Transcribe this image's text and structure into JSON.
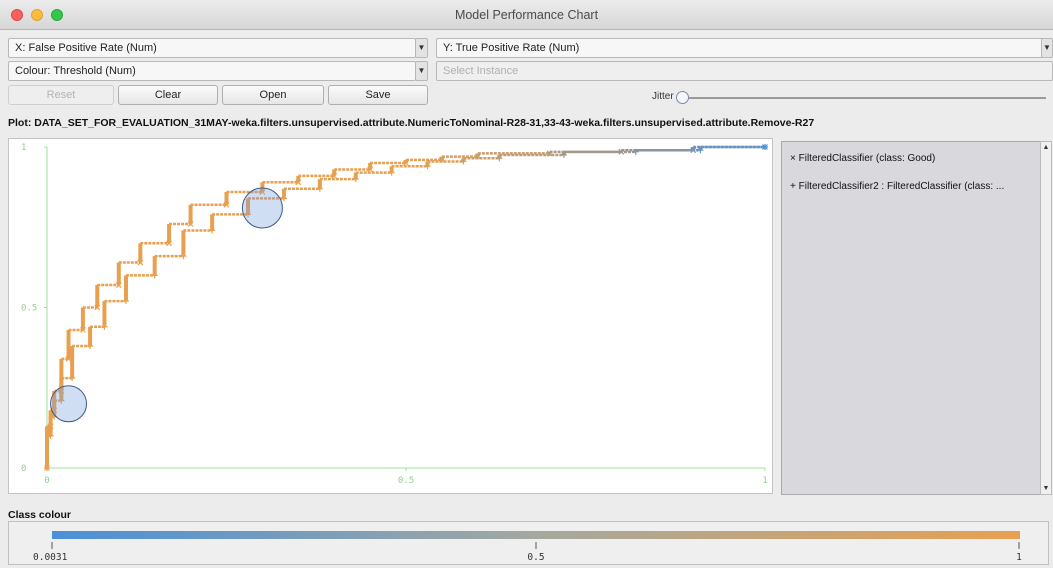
{
  "window": {
    "title": "Model Performance Chart"
  },
  "controls": {
    "x_axis": "X: False Positive Rate (Num)",
    "y_axis": "Y: True Positive Rate (Num)",
    "colour": "Colour: Threshold (Num)",
    "select_instance_placeholder": "Select Instance",
    "reset_label": "Reset",
    "clear_label": "Clear",
    "open_label": "Open",
    "save_label": "Save",
    "jitter_label": "Jitter",
    "jitter_value": 0
  },
  "plot": {
    "label": "Plot: DATA_SET_FOR_EVALUATION_31MAY-weka.filters.unsupervised.attribute.NumericToNominal-R28-31,33-43-weka.filters.unsupervised.attribute.Remove-R27"
  },
  "legend": {
    "items": [
      "× FilteredClassifier (class: Good)",
      "+ FilteredClassifier2 : FilteredClassifier (class: ..."
    ]
  },
  "class_colour": {
    "label": "Class colour",
    "min_label": "0.0031",
    "mid_label": "0.5",
    "max_label": "1",
    "colors": {
      "low": "#4a90d9",
      "high": "#e8a050"
    }
  },
  "chart_data": {
    "type": "scatter",
    "title": "",
    "xlabel": "",
    "ylabel": "",
    "xlim": [
      0,
      1
    ],
    "ylim": [
      0,
      1
    ],
    "x_ticks": [
      "0",
      "0.5",
      "1"
    ],
    "y_ticks": [
      "0",
      "0.5",
      "1"
    ],
    "grid": false,
    "series": [
      {
        "name": "FilteredClassifier (class: Good)",
        "marker": "x",
        "x": [
          0.0,
          0.005,
          0.01,
          0.02,
          0.03,
          0.05,
          0.07,
          0.1,
          0.13,
          0.17,
          0.2,
          0.25,
          0.3,
          0.35,
          0.4,
          0.45,
          0.5,
          0.55,
          0.6,
          0.7,
          0.8,
          0.9,
          1.0
        ],
        "y": [
          0.0,
          0.13,
          0.18,
          0.24,
          0.34,
          0.43,
          0.5,
          0.57,
          0.64,
          0.7,
          0.76,
          0.82,
          0.86,
          0.89,
          0.91,
          0.93,
          0.95,
          0.96,
          0.97,
          0.98,
          0.985,
          0.99,
          1.0
        ]
      },
      {
        "name": "FilteredClassifier2 : FilteredClassifier (class: ...",
        "marker": "+",
        "x": [
          0.0,
          0.005,
          0.01,
          0.02,
          0.035,
          0.06,
          0.08,
          0.11,
          0.15,
          0.19,
          0.23,
          0.28,
          0.33,
          0.38,
          0.43,
          0.48,
          0.53,
          0.58,
          0.63,
          0.72,
          0.82,
          0.91,
          1.0
        ],
        "y": [
          0.0,
          0.1,
          0.16,
          0.21,
          0.28,
          0.38,
          0.44,
          0.52,
          0.6,
          0.66,
          0.74,
          0.79,
          0.84,
          0.87,
          0.9,
          0.92,
          0.94,
          0.955,
          0.965,
          0.975,
          0.985,
          0.99,
          1.0
        ]
      }
    ],
    "annotations": [
      {
        "shape": "circle",
        "x": 0.03,
        "y": 0.2
      },
      {
        "shape": "circle",
        "x": 0.3,
        "y": 0.81
      }
    ]
  }
}
